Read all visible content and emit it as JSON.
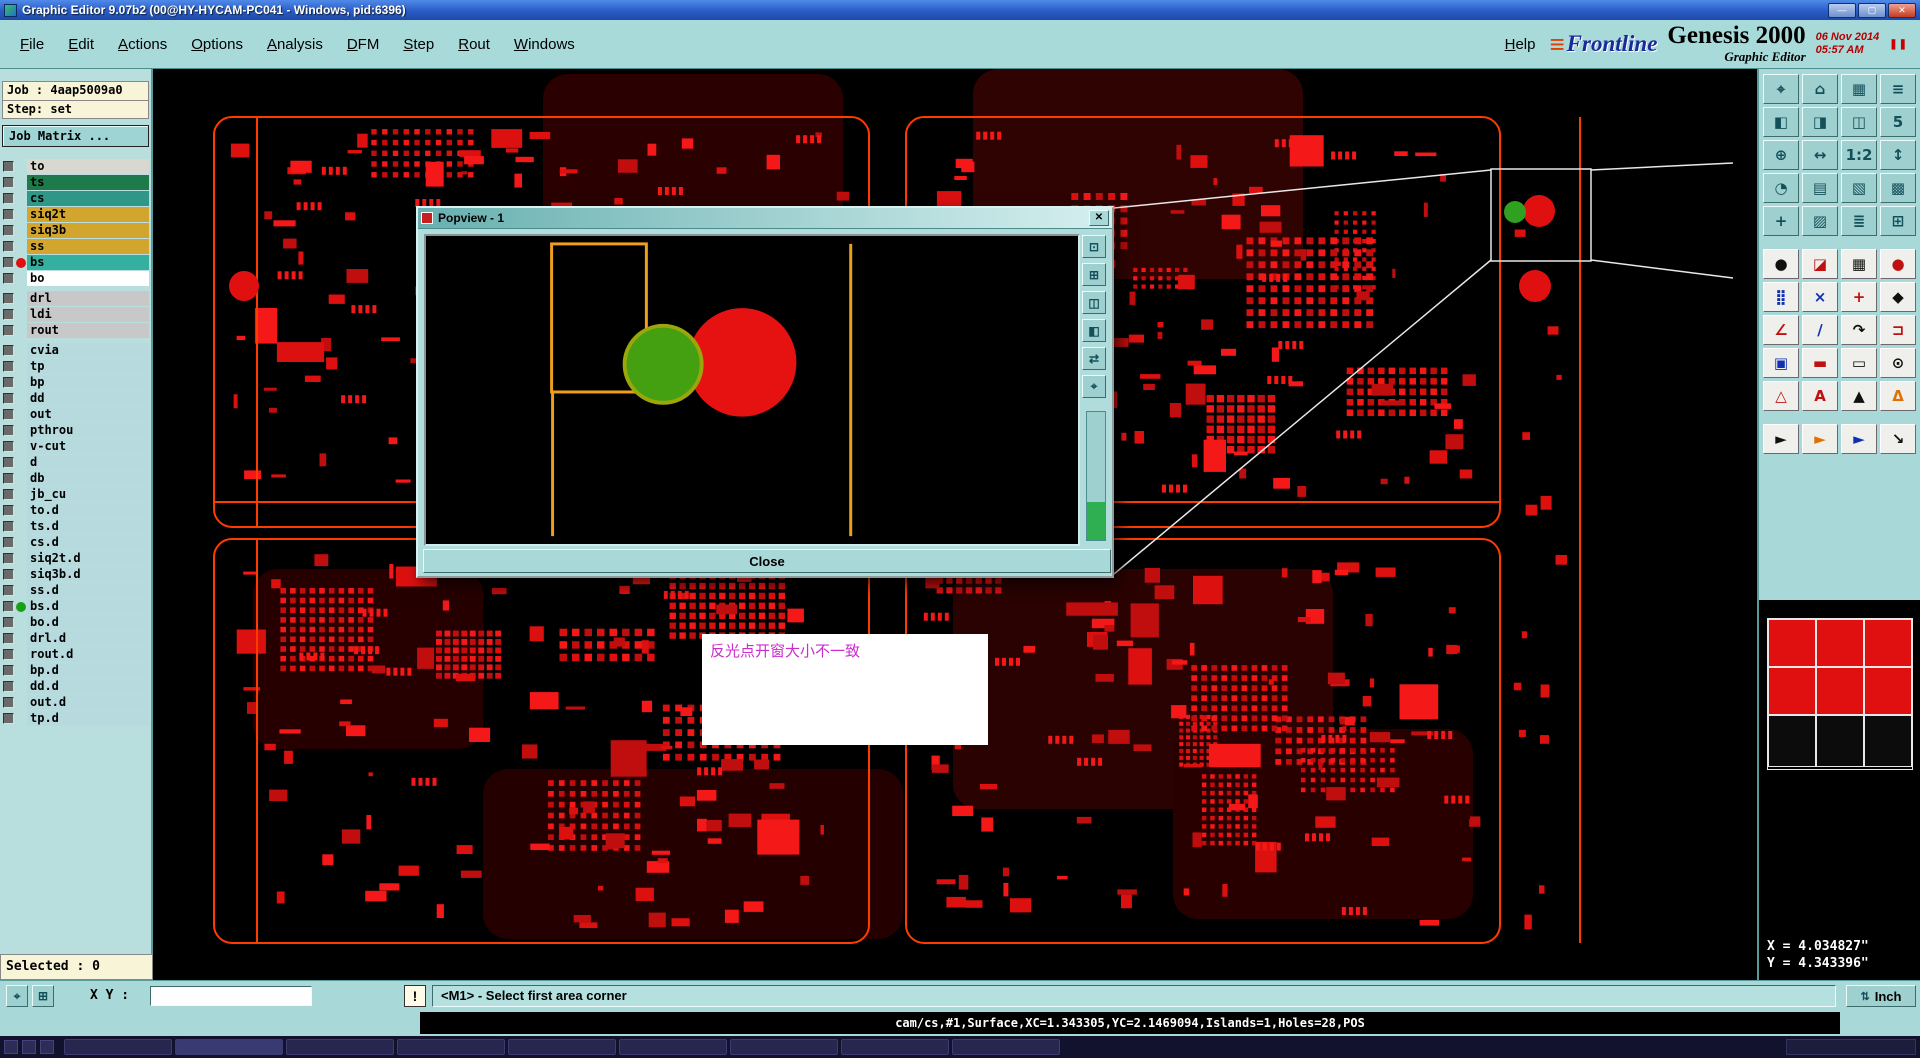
{
  "window": {
    "title": "Graphic Editor 9.07b2 (00@HY-HYCAM-PC041 - Windows, pid:6396)",
    "controls": {
      "minimize": "—",
      "maximize": "▢",
      "close": "✕"
    }
  },
  "menu": {
    "items": [
      {
        "label": "File"
      },
      {
        "label": "Edit"
      },
      {
        "label": "Actions"
      },
      {
        "label": "Options"
      },
      {
        "label": "Analysis"
      },
      {
        "label": "DFM"
      },
      {
        "label": "Step"
      },
      {
        "label": "Rout"
      },
      {
        "label": "Windows"
      }
    ],
    "help": "Help"
  },
  "brand": {
    "logo_text": "Frontline",
    "product": "Genesis 2000",
    "subtitle": "Graphic Editor",
    "date": "06 Nov 2014",
    "time": "05:57 AM"
  },
  "job_panel": {
    "job": "Job : 4aap5009a0",
    "step": "Step: set",
    "matrix_button": "Job Matrix ..."
  },
  "layers": {
    "groups": [
      {
        "rows": [
          {
            "name": "to",
            "color": "#d8d8d0"
          },
          {
            "name": "ts",
            "color": "#1e7a4a"
          },
          {
            "name": "cs",
            "color": "#2f9688"
          },
          {
            "name": "siq2t",
            "color": "#d2a62e"
          },
          {
            "name": "siq3b",
            "color": "#d2a62e"
          },
          {
            "name": "ss",
            "color": "#d2a62e"
          },
          {
            "name": "bs",
            "color": "#35b0a0",
            "dot": "#e01010"
          },
          {
            "name": "bo",
            "color": "#ffffff"
          }
        ]
      },
      {
        "rows": [
          {
            "name": "drl",
            "color": "#c8c8c8"
          },
          {
            "name": "ldi",
            "color": "#c8c8c8"
          },
          {
            "name": "rout",
            "color": "#c8c8c8"
          }
        ]
      },
      {
        "rows": [
          {
            "name": "cvia",
            "color": "#b6dade"
          },
          {
            "name": "tp",
            "color": "#b6dade"
          },
          {
            "name": "bp",
            "color": "#b6dade"
          },
          {
            "name": "dd",
            "color": "#b6dade"
          },
          {
            "name": "out",
            "color": "#b6dade"
          },
          {
            "name": "pthrou",
            "color": "#b6dade"
          },
          {
            "name": "v-cut",
            "color": "#b6dade"
          },
          {
            "name": "d",
            "color": "#b6dade"
          },
          {
            "name": "db",
            "color": "#b6dade"
          },
          {
            "name": "jb_cu",
            "color": "#b6dade"
          },
          {
            "name": "to.d",
            "color": "#b6dade"
          },
          {
            "name": "ts.d",
            "color": "#b6dade"
          },
          {
            "name": "cs.d",
            "color": "#b6dade"
          },
          {
            "name": "siq2t.d",
            "color": "#b6dade"
          },
          {
            "name": "siq3b.d",
            "color": "#b6dade"
          },
          {
            "name": "ss.d",
            "color": "#b6dade"
          },
          {
            "name": "bs.d",
            "color": "#b6dade",
            "dot": "#18a018"
          },
          {
            "name": "bo.d",
            "color": "#b6dade"
          },
          {
            "name": "drl.d",
            "color": "#b6dade"
          },
          {
            "name": "rout.d",
            "color": "#b6dade"
          },
          {
            "name": "bp.d",
            "color": "#b6dade"
          },
          {
            "name": "dd.d",
            "color": "#b6dade"
          },
          {
            "name": "out.d",
            "color": "#b6dade"
          },
          {
            "name": "tp.d",
            "color": "#b6dade"
          }
        ]
      }
    ]
  },
  "right_toolbar": {
    "top": [
      {
        "name": "center-view-button",
        "glyph": "⌖"
      },
      {
        "name": "home-view-button",
        "glyph": "⌂"
      },
      {
        "name": "grid-view-button",
        "glyph": "▦"
      },
      {
        "name": "layer-list-button",
        "glyph": "≡"
      },
      {
        "name": "pan-left-button",
        "glyph": "◧"
      },
      {
        "name": "pan-right-button",
        "glyph": "◨"
      },
      {
        "name": "split-view-button",
        "glyph": "◫"
      },
      {
        "name": "zoom-5-button",
        "glyph": "5"
      },
      {
        "name": "zoom-in-button",
        "glyph": "⊕"
      },
      {
        "name": "fit-width-button",
        "glyph": "↔"
      },
      {
        "name": "zoom-1-2-button",
        "glyph": "1:2"
      },
      {
        "name": "fit-height-button",
        "glyph": "↕"
      },
      {
        "name": "rotate-view-button",
        "glyph": "◔"
      },
      {
        "name": "rows-view-button",
        "glyph": "▤"
      },
      {
        "name": "hatch-view-button",
        "glyph": "▧"
      },
      {
        "name": "fill-view-button",
        "glyph": "▩"
      },
      {
        "name": "add-view-button",
        "glyph": "+"
      },
      {
        "name": "pattern-view-button",
        "glyph": "▨"
      },
      {
        "name": "list-view-button",
        "glyph": "≣"
      },
      {
        "name": "new-window-button",
        "glyph": "⊞"
      }
    ],
    "mid": [
      {
        "name": "pad-tool-button",
        "glyph": "●",
        "color": "#101010"
      },
      {
        "name": "quadrant-tool-button",
        "glyph": "◪",
        "color": "#c01010"
      },
      {
        "name": "mesh-tool-button",
        "glyph": "▦",
        "color": "#101010"
      },
      {
        "name": "red-pad-tool-button",
        "glyph": "●",
        "color": "#c01010"
      },
      {
        "name": "bga-grid-tool-button",
        "glyph": "⣿",
        "color": "#1030b0"
      },
      {
        "name": "delete-tool-button",
        "glyph": "×",
        "color": "#1030b0"
      },
      {
        "name": "add-feature-button",
        "glyph": "+",
        "color": "#c01010"
      },
      {
        "name": "diamond-tool-button",
        "glyph": "◆",
        "color": "#101010"
      },
      {
        "name": "angle-tool-button",
        "glyph": "∠",
        "color": "#c01010"
      },
      {
        "name": "line-tool-button",
        "glyph": "∕",
        "color": "#1030b0"
      },
      {
        "name": "rotate-tool-button",
        "glyph": "↷",
        "color": "#101010"
      },
      {
        "name": "open-rect-tool-button",
        "glyph": "⊐",
        "color": "#c01010"
      },
      {
        "name": "filled-rect-tool-button",
        "glyph": "▣",
        "color": "#1030b0"
      },
      {
        "name": "bar-tool-button",
        "glyph": "▬",
        "color": "#c01010"
      },
      {
        "name": "rect-outline-tool-button",
        "glyph": "▭",
        "color": "#101010"
      },
      {
        "name": "circle-center-tool-button",
        "glyph": "⊙",
        "color": "#101010"
      },
      {
        "name": "triangle-tool-button",
        "glyph": "△",
        "color": "#c01010"
      },
      {
        "name": "text-tool-button",
        "glyph": "A",
        "color": "#c01010"
      },
      {
        "name": "filled-triangle-tool-button",
        "glyph": "▲",
        "color": "#101010"
      },
      {
        "name": "delta-tool-button",
        "glyph": "Δ",
        "color": "#e07000"
      }
    ],
    "arrows": [
      {
        "name": "select-arrow-button",
        "glyph": "►",
        "color": "#101010"
      },
      {
        "name": "highlight-arrow-button",
        "glyph": "►",
        "color": "#e07000"
      },
      {
        "name": "multi-select-arrow-button",
        "glyph": "►",
        "color": "#1030b0"
      },
      {
        "name": "resize-arrow-button",
        "glyph": "↘",
        "color": "#101010"
      }
    ]
  },
  "popview": {
    "title": "Popview - 1",
    "close_button": "Close",
    "tools": [
      {
        "name": "pv-fit-button",
        "glyph": "⊡"
      },
      {
        "name": "pv-zoom-in-button",
        "glyph": "⊞"
      },
      {
        "name": "pv-split-button",
        "glyph": "◫"
      },
      {
        "name": "pv-half-button",
        "glyph": "◧"
      },
      {
        "name": "pv-swap-button",
        "glyph": "⇄"
      },
      {
        "name": "pv-center-button",
        "glyph": "⌖"
      }
    ]
  },
  "annotation": {
    "text": "反光点开窗大小不一致"
  },
  "coords": {
    "x": "X = 4.034827\"",
    "y": "Y = 4.343396\""
  },
  "status": {
    "selected": "Selected : 0",
    "xy_label": "X Y :",
    "xy_value": "",
    "prompt": "<M1> - Select first area corner",
    "info": "cam/cs,#1,Surface,XC=1.343305,YC=2.1469094,Islands=1,Holes=28,POS",
    "units": "Inch"
  },
  "icons": {
    "logo_bars": "≡",
    "pause": "❚❚",
    "snap": "⌖",
    "grid": "⊞",
    "alert": "!",
    "units_spinner": "⇅",
    "popview_close_x": "✕"
  },
  "palette": {
    "pcb_red": "#dd1010",
    "pcb_red_bright": "#f51818",
    "pcb_red_dark": "#c00d0d",
    "pcb_outline": "#ff3c00",
    "annotation_text": "#cc2ccc"
  }
}
